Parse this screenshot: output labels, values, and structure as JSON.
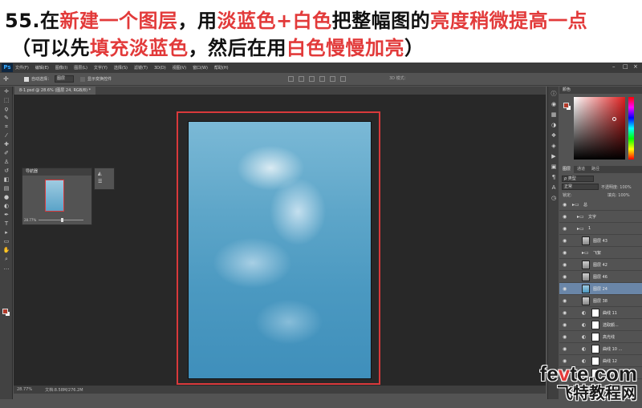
{
  "caption": {
    "line1": [
      {
        "text": "55.在",
        "red": false
      },
      {
        "text": "新建一个图层",
        "red": true
      },
      {
        "text": "，用",
        "red": false
      },
      {
        "text": "淡蓝色+白色",
        "red": true
      },
      {
        "text": "把整幅图的",
        "red": false
      },
      {
        "text": "亮度稍微提高一点",
        "red": true
      }
    ],
    "line2": [
      {
        "text": "（可以先",
        "red": false
      },
      {
        "text": "填充淡蓝色",
        "red": true
      },
      {
        "text": "，然后在用",
        "red": false
      },
      {
        "text": "白色慢慢加亮",
        "red": true
      },
      {
        "text": "）",
        "red": false
      }
    ]
  },
  "app": {
    "logo": "Ps",
    "menu": [
      "文件(F)",
      "编辑(E)",
      "图像(I)",
      "图层(L)",
      "文字(Y)",
      "选择(S)",
      "滤镜(T)",
      "3D(D)",
      "视图(V)",
      "窗口(W)",
      "帮助(H)"
    ],
    "window_buttons": [
      "–",
      "□",
      "×"
    ]
  },
  "options": {
    "auto_select_label": "自动选择：",
    "auto_select_value": "图层",
    "show_transform": "显示变换控件",
    "mode_3d": "3D 模式："
  },
  "document_tab": "8-1.psd @ 28.6% (图层 24, RGB/8) *",
  "navigator": {
    "title": "导航器",
    "zoom": "28.77%"
  },
  "status": {
    "zoom": "28.77%",
    "doc": "文档:8.58M/276.2M"
  },
  "panels": {
    "color_title": "颜色",
    "layer_tabs": [
      "图层",
      "通道",
      "路径"
    ],
    "filter_label": "ρ 类型",
    "blend_mode": "正常",
    "opacity": "不透明度: 100%",
    "lock_label": "锁定:",
    "fill": "填充: 100%"
  },
  "layers": [
    {
      "name": "总",
      "type": "folder",
      "indent": 0,
      "selected": false
    },
    {
      "name": "文字",
      "type": "folder",
      "indent": 1,
      "selected": false
    },
    {
      "name": "1",
      "type": "folder",
      "indent": 1,
      "selected": false
    },
    {
      "name": "图层 43",
      "type": "layer",
      "indent": 2,
      "selected": false
    },
    {
      "name": "飞絮",
      "type": "folder",
      "indent": 2,
      "selected": false
    },
    {
      "name": "图层 42",
      "type": "layer",
      "indent": 2,
      "selected": false
    },
    {
      "name": "图层 46",
      "type": "layer",
      "indent": 2,
      "selected": false
    },
    {
      "name": "图层 24",
      "type": "layer",
      "indent": 2,
      "selected": true
    },
    {
      "name": "图层 38",
      "type": "layer",
      "indent": 2,
      "selected": false
    },
    {
      "name": "曲线 11",
      "type": "adjust",
      "indent": 2,
      "selected": false
    },
    {
      "name": "选取颜...",
      "type": "adjust",
      "indent": 2,
      "selected": false
    },
    {
      "name": "高光线",
      "type": "adjust",
      "indent": 2,
      "selected": false
    },
    {
      "name": "曲线 10 ...",
      "type": "adjust",
      "indent": 2,
      "selected": false
    },
    {
      "name": "曲线 12",
      "type": "adjust",
      "indent": 2,
      "selected": false
    },
    {
      "name": "选取颜...",
      "type": "adjust",
      "indent": 2,
      "selected": false
    }
  ],
  "watermark": {
    "top_a": "fe",
    "top_o": "v",
    "top_b": "te.com",
    "bottom": "飞特教程网"
  },
  "colors": {
    "accent_red": "#d9393b",
    "foreground": "#b23a2a",
    "selection_blue": "#6a86a8"
  },
  "icons": {
    "tools": [
      "move-icon",
      "marquee-icon",
      "lasso-icon",
      "quick-select-icon",
      "crop-icon",
      "eyedropper-icon",
      "healing-icon",
      "brush-icon",
      "stamp-icon",
      "history-brush-icon",
      "eraser-icon",
      "gradient-icon",
      "blur-icon",
      "dodge-icon",
      "pen-icon",
      "type-icon",
      "path-select-icon",
      "shape-icon",
      "hand-icon",
      "zoom-icon",
      "more-icon"
    ],
    "strip": [
      "info-icon",
      "color-icon",
      "brush-preset-icon",
      "adjust-icon",
      "styles-icon",
      "layers-icon",
      "play-icon",
      "properties-icon",
      "paragraph-icon",
      "char-icon",
      "history-icon"
    ]
  }
}
